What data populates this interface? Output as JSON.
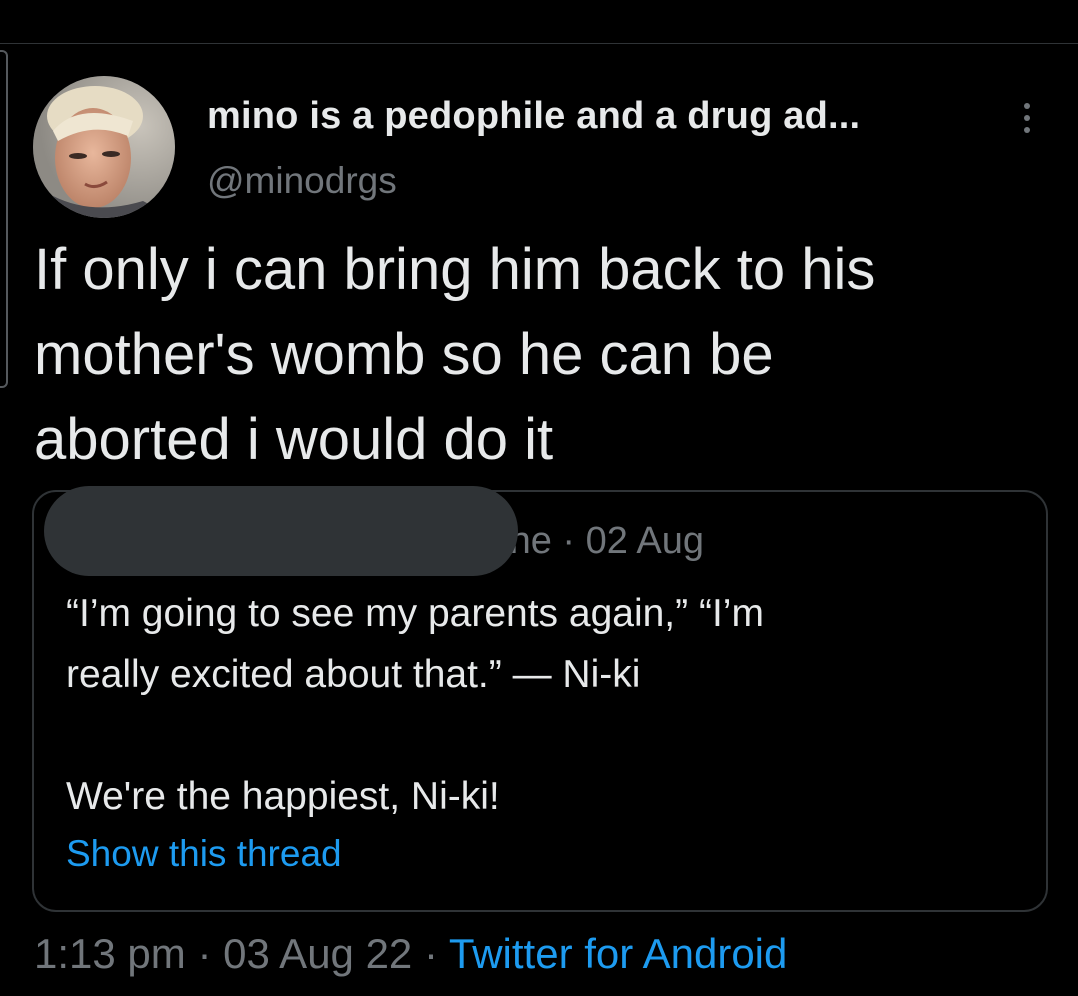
{
  "tweet": {
    "display_name": "mino is a pedophile and a drug ad...",
    "handle": "@minodrgs",
    "text": "If only i can bring him back to his\nmother's womb so he can be\naborted i would do it",
    "time": "1:13 pm",
    "separator": "·",
    "date": "03 Aug 22",
    "source": "Twitter for Android"
  },
  "quoted_tweet": {
    "meta_visible": " ne · 02 Aug",
    "text_1": "“I’m going to see my parents again,” “I’m\nreally excited about that.” — Ni-ki",
    "text_2": "We're the happiest, Ni-ki!",
    "show_thread_label": "Show this thread"
  },
  "icons": {
    "more": "more-vertical-icon"
  },
  "colors": {
    "background": "#000000",
    "primary_text": "#e7e9ea",
    "secondary_text": "#71767b",
    "link": "#1d9bf0",
    "border": "#2f3336"
  }
}
